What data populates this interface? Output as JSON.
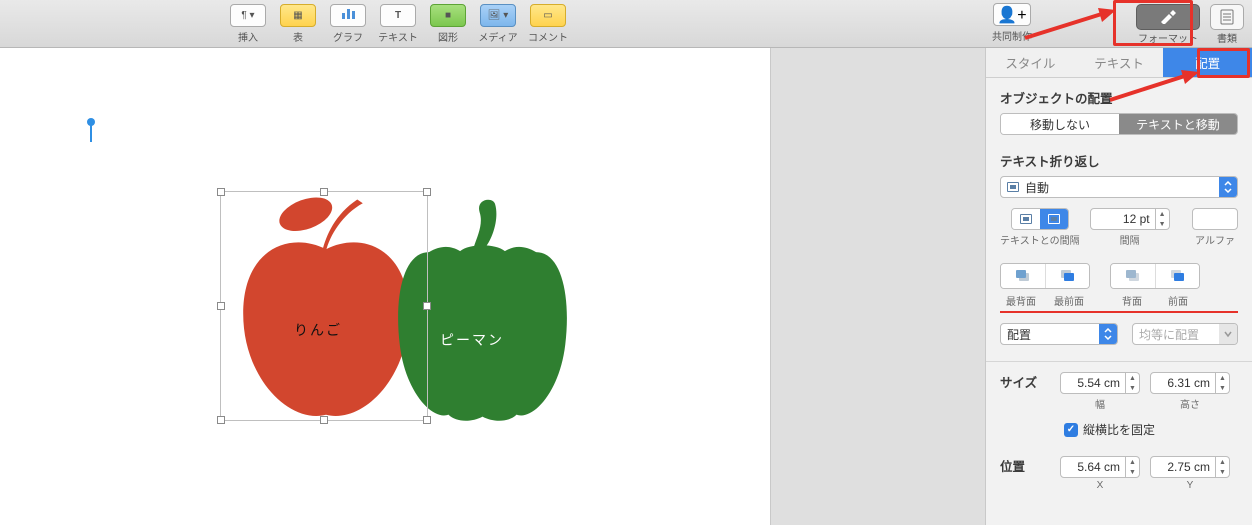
{
  "toolbar": {
    "items": [
      {
        "label": "挿入"
      },
      {
        "label": "表"
      },
      {
        "label": "グラフ"
      },
      {
        "label": "テキスト"
      },
      {
        "label": "図形"
      },
      {
        "label": "メディア"
      },
      {
        "label": "コメント"
      }
    ],
    "collaborate": "共同制作",
    "format": "フォーマット",
    "document": "書類"
  },
  "canvas": {
    "apple_label": "りんご",
    "pepper_label": "ピーマン"
  },
  "inspector": {
    "tabs": {
      "style": "スタイル",
      "text": "テキスト",
      "arrange": "配置"
    },
    "object_placement": "オブジェクトの配置",
    "stay": "移動しない",
    "move_with_text": "テキストと移動",
    "text_wrap": "テキスト折り返し",
    "wrap_auto": "自動",
    "text_spacing": "テキストとの間隔",
    "spacing_label": "間隔",
    "spacing_value": "12 pt",
    "alpha": "アルファ",
    "back_most": "最背面",
    "front_most": "最前面",
    "back": "背面",
    "front": "前面",
    "align": "配置",
    "distribute": "均等に配置",
    "size": "サイズ",
    "width_val": "5.54 cm",
    "width_label": "幅",
    "height_val": "6.31 cm",
    "height_label": "高さ",
    "constrain": "縦横比を固定",
    "position": "位置",
    "x_val": "5.64 cm",
    "x_label": "X",
    "y_val": "2.75 cm",
    "y_label": "Y"
  }
}
